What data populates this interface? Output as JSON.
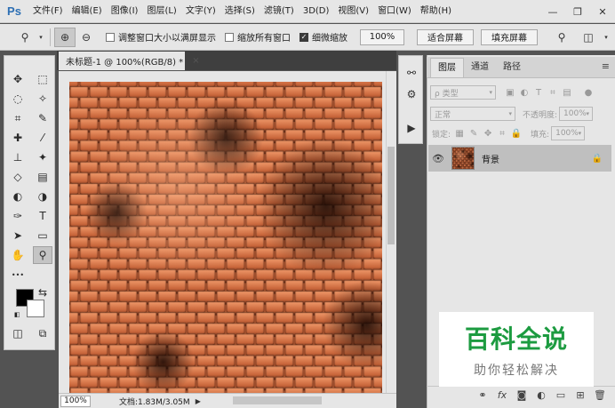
{
  "app": {
    "logo": "Ps",
    "menu": [
      "文件(F)",
      "编辑(E)",
      "图像(I)",
      "图层(L)",
      "文字(Y)",
      "选择(S)",
      "滤镜(T)",
      "3D(D)",
      "视图(V)",
      "窗口(W)",
      "帮助(H)"
    ],
    "window_controls": {
      "minimize": "—",
      "restore": "❐",
      "close": "✕"
    }
  },
  "options_bar": {
    "tool_icon": "zoom-icon",
    "zoom_in": "⊕",
    "zoom_out": "⊖",
    "resize_windows": {
      "label": "调整窗口大小以满屏显示",
      "checked": false
    },
    "zoom_all": {
      "label": "缩放所有窗口",
      "checked": false
    },
    "scrubby": {
      "label": "细微缩放",
      "checked": true
    },
    "btn_100": "100%",
    "btn_fit": "适合屏幕",
    "btn_fill": "填充屏幕"
  },
  "document": {
    "tab_title": "未标题-1 @ 100%(RGB/8) *",
    "tab_close": "×",
    "zoom": "100%",
    "doc_info": "文档:1.83M/3.05M",
    "pattern_colors": {
      "light": "#f0996a",
      "mid": "#c8653a",
      "dark": "#3a1208",
      "deep": "#1a0804"
    }
  },
  "tools": [
    {
      "icon": "✥",
      "name": "move-tool-icon"
    },
    {
      "icon": "⬚",
      "name": "marquee-tool-icon"
    },
    {
      "icon": "◌",
      "name": "lasso-tool-icon"
    },
    {
      "icon": "✧",
      "name": "magic-wand-tool-icon"
    },
    {
      "icon": "⌗",
      "name": "crop-tool-icon"
    },
    {
      "icon": "✎",
      "name": "eyedropper-tool-icon"
    },
    {
      "icon": "✚",
      "name": "healing-brush-tool-icon"
    },
    {
      "icon": "⁄",
      "name": "brush-tool-icon"
    },
    {
      "icon": "⊥",
      "name": "stamp-tool-icon"
    },
    {
      "icon": "✦",
      "name": "history-brush-tool-icon"
    },
    {
      "icon": "◇",
      "name": "eraser-tool-icon"
    },
    {
      "icon": "▤",
      "name": "gradient-tool-icon"
    },
    {
      "icon": "◐",
      "name": "blur-tool-icon"
    },
    {
      "icon": "◑",
      "name": "dodge-tool-icon"
    },
    {
      "icon": "✑",
      "name": "pen-tool-icon"
    },
    {
      "icon": "T",
      "name": "type-tool-icon"
    },
    {
      "icon": "➤",
      "name": "path-selection-tool-icon"
    },
    {
      "icon": "▭",
      "name": "rectangle-tool-icon"
    },
    {
      "icon": "✋",
      "name": "hand-tool-icon"
    },
    {
      "icon": "⚲",
      "name": "zoom-tool-icon"
    },
    {
      "icon": "•••",
      "name": "more-tools-icon"
    },
    {
      "icon": "⇆",
      "name": "swap-colors-icon"
    },
    {
      "icon": "◫",
      "name": "quick-mask-icon"
    },
    {
      "icon": "⧉",
      "name": "screen-mode-icon"
    }
  ],
  "colors": {
    "foreground": "#000000",
    "background": "#ffffff"
  },
  "mini_strip": [
    "⚯",
    "⚙",
    "▶"
  ],
  "layers_panel": {
    "tabs": [
      "图层",
      "通道",
      "路径"
    ],
    "active_tab": 0,
    "menu_icon": "≡",
    "filter_type": "ρ 类型",
    "blend_mode": "正常",
    "opacity_label": "不透明度:",
    "opacity_value": "100%",
    "lock_label": "锁定:",
    "fill_label": "填充:",
    "fill_value": "100%",
    "layer": {
      "name": "背景",
      "visible_icon": "👁",
      "lock_icon": "🔒"
    },
    "bottom_icons": [
      "⚭",
      "fx",
      "◙",
      "◐",
      "▭",
      "⊞",
      "🗑"
    ]
  },
  "watermark": {
    "title": "百科全说",
    "subtitle": "助你轻松解决"
  }
}
